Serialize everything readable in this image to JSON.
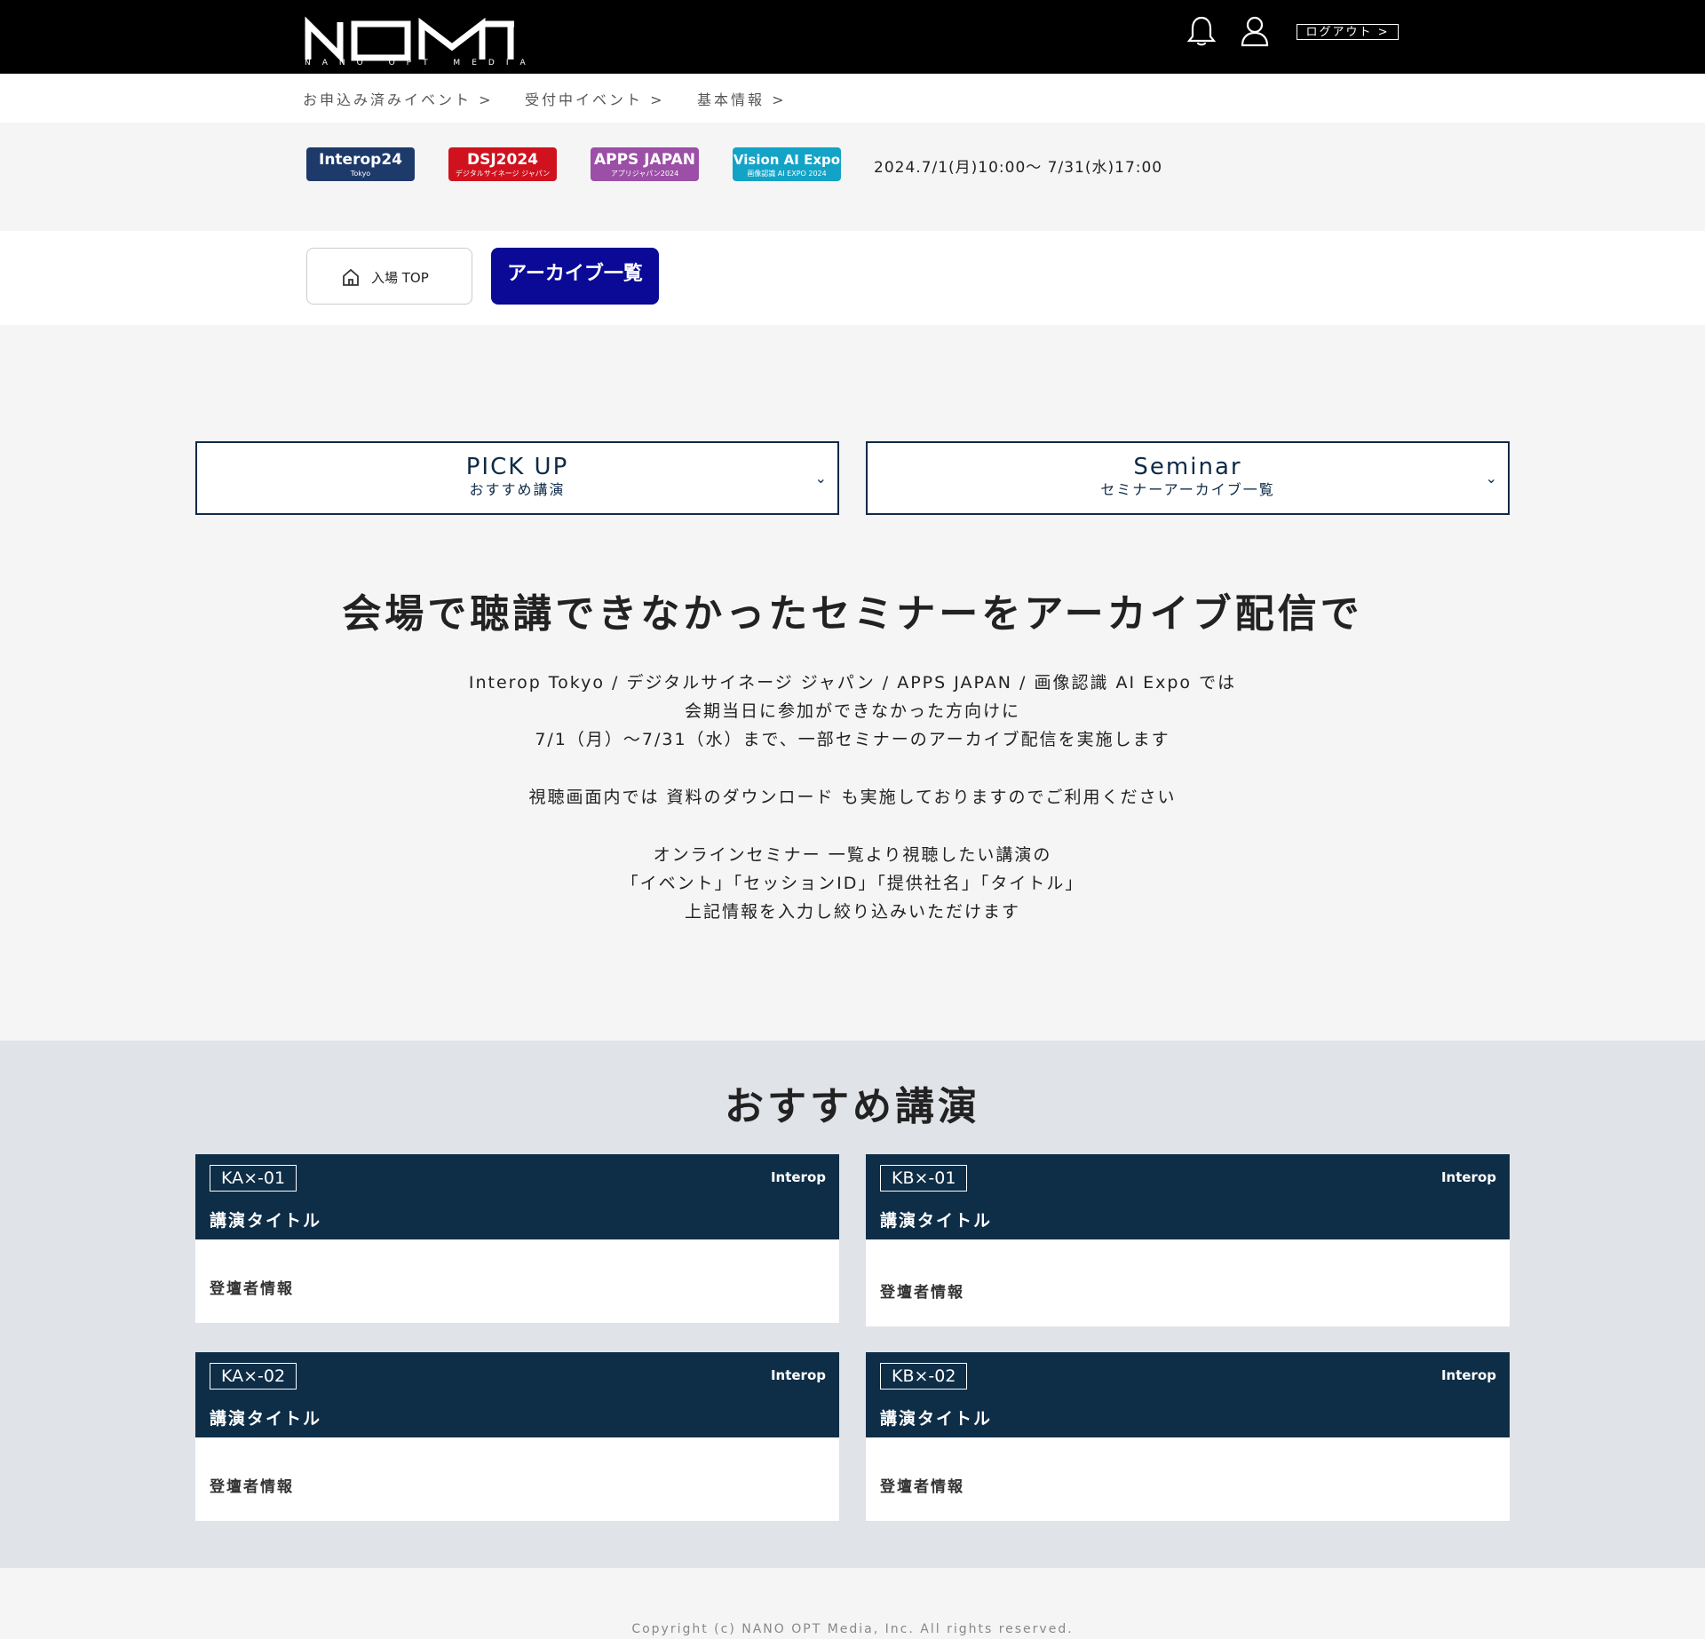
{
  "header": {
    "logo_text": "NOM",
    "logo_subtext": "NANO OPT MEDIA",
    "logout_label": "ログアウト >"
  },
  "subnav": {
    "items": [
      {
        "label": "お申込み済みイベント  >"
      },
      {
        "label": "受付中イベント  >"
      },
      {
        "label": "基本情報  >"
      }
    ]
  },
  "events": {
    "badges": [
      {
        "line1": "Interop24",
        "line2": "Tokyo",
        "color": "#1e3a6a"
      },
      {
        "line1": "DSJ2024",
        "line2": "デジタルサイネージ ジャパン",
        "color": "#d0121e"
      },
      {
        "line1": "APPS JAPAN",
        "line2": "アプリジャパン2024",
        "color": "#9b4fa6"
      },
      {
        "line1": "Vision AI Expo",
        "line2": "画像認識 AI EXPO 2024",
        "color": "#13a3c7"
      }
    ],
    "date_range": "2024.7/1(月)10:00～ 7/31(水)17:00"
  },
  "tabs": {
    "top_label": "入場 TOP",
    "archive_label": "アーカイブ一覧",
    "active_color": "#0a0a96"
  },
  "selects": [
    {
      "title": "PICK UP",
      "subtitle": "おすすめ講演"
    },
    {
      "title": "Seminar",
      "subtitle": "セミナーアーカイブ一覧"
    }
  ],
  "intro": {
    "headline": "会場で聴講できなかったセミナーをアーカイブ配信で",
    "lines": [
      "Interop Tokyo / デジタルサイネージ ジャパン / APPS JAPAN / 画像認識 AI Expo では",
      "会期当日に参加ができなかった方向けに",
      "7/1（月）～7/31（水）まで、一部セミナーのアーカイブ配信を実施します",
      "視聴画面内では 資料のダウンロード も実施しておりますのでご利用ください",
      "オンラインセミナー 一覧より視聴したい講演の",
      "「イベント」「セッションID」「提供社名」「タイトル」",
      "上記情報を入力し絞り込みいただけます"
    ]
  },
  "recommended": {
    "title": "おすすめ講演",
    "cards": [
      {
        "code": "KA×-01",
        "tag": "Interop",
        "title": "講演タイトル",
        "info": "登壇者情報"
      },
      {
        "code": "KB×-01",
        "tag": "Interop",
        "title": "講演タイトル",
        "info": "登壇者情報"
      },
      {
        "code": "KA×-02",
        "tag": "Interop",
        "title": "講演タイトル",
        "info": "登壇者情報"
      },
      {
        "code": "KB×-02",
        "tag": "Interop",
        "title": "講演タイトル",
        "info": "登壇者情報"
      }
    ]
  },
  "footer": {
    "copyright": "Copyright (c) NANO OPT Media, Inc. All rights reserved."
  }
}
